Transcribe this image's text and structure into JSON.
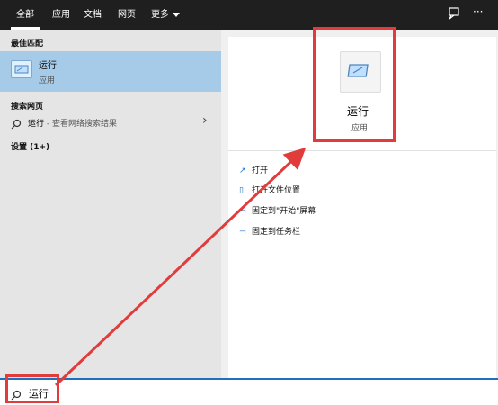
{
  "topbar": {
    "tabs": [
      {
        "label": "全部",
        "active": true
      },
      {
        "label": "应用"
      },
      {
        "label": "文档"
      },
      {
        "label": "网页"
      },
      {
        "label": "更多"
      }
    ],
    "feedback_icon": "feedback-icon",
    "more_icon_label": "···"
  },
  "left": {
    "best_match_header": "最佳匹配",
    "best_match": {
      "title": "运行",
      "subtitle": "应用",
      "icon": "run-app-icon"
    },
    "web_header": "搜索网页",
    "web_item": {
      "query": "运行",
      "suffix": " - 查看网络搜索结果",
      "icon": "search-icon",
      "chevron": "›"
    },
    "settings_header": "设置 (1+)"
  },
  "right": {
    "app": {
      "title": "运行",
      "subtitle": "应用",
      "icon": "run-app-icon"
    },
    "actions": [
      {
        "label": "打开",
        "icon": "open-icon"
      },
      {
        "label": "打开文件位置",
        "icon": "file-location-icon"
      },
      {
        "label": "固定到\"开始\"屏幕",
        "icon": "pin-start-icon"
      },
      {
        "label": "固定到任务栏",
        "icon": "pin-taskbar-icon"
      }
    ]
  },
  "search": {
    "value": "运行",
    "icon": "search-icon"
  },
  "annotation": {
    "color": "#e23b3b"
  },
  "colors": {
    "accent": "#1f6fbf",
    "highlight": "#a6cbe8",
    "topbar": "#1f1f1f"
  }
}
